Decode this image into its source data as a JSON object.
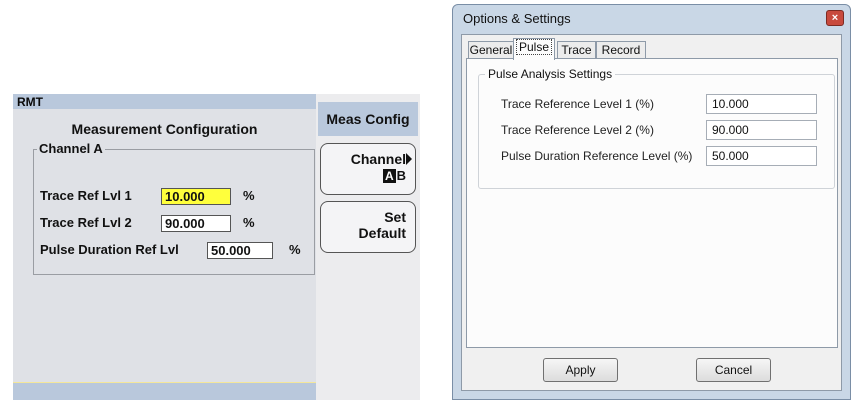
{
  "instrument": {
    "status": "RMT",
    "title": "Measurement Configuration",
    "group_label": "Channel A",
    "rows": [
      {
        "label": "Trace Ref Lvl 1",
        "value": "10.000",
        "unit": "%"
      },
      {
        "label": "Trace Ref Lvl 2",
        "value": "90.000",
        "unit": "%"
      },
      {
        "label": "Pulse Duration Ref Lvl",
        "value": "50.000",
        "unit": "%"
      }
    ],
    "softkeys": {
      "header": "Meas Config",
      "channel_label": "Channel",
      "channel_selected": "A",
      "channel_other": "B",
      "set_default_line1": "Set",
      "set_default_line2": "Default"
    },
    "colors": {
      "highlight": "#ffff3c",
      "status_bar": "#b9c8dc"
    }
  },
  "dialog": {
    "title": "Options & Settings",
    "close_glyph": "×",
    "tabs": [
      "General",
      "Pulse",
      "Trace",
      "Record"
    ],
    "active_tab": "Pulse",
    "group_label": "Pulse Analysis Settings",
    "rows": [
      {
        "label": "Trace Reference Level 1 (%)",
        "value": "10.000"
      },
      {
        "label": "Trace Reference Level 2 (%)",
        "value": "90.000"
      },
      {
        "label": "Pulse Duration Reference Level (%)",
        "value": "50.000"
      }
    ],
    "apply_label": "Apply",
    "cancel_label": "Cancel"
  }
}
